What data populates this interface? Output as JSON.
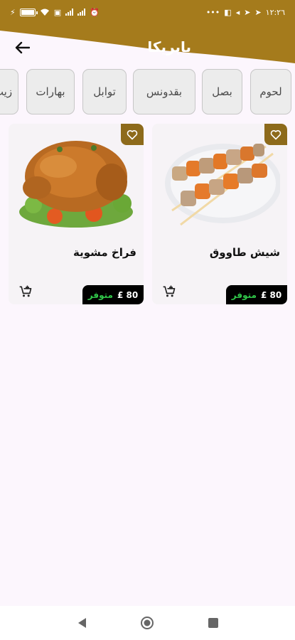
{
  "status_bar": {
    "time": "١٢:٢٦",
    "battery_level": 1.0
  },
  "header": {
    "title": "بابريكا",
    "bg_color": "#a57b1c"
  },
  "categories": [
    {
      "label": "لحوم"
    },
    {
      "label": "بصل"
    },
    {
      "label": "بقدونس"
    },
    {
      "label": "توابل"
    },
    {
      "label": "بهارات"
    },
    {
      "label": "زيت"
    }
  ],
  "products": [
    {
      "name": "شيش طاووق",
      "price": "80 £",
      "stock": "متوفر",
      "image_icon": "shish-tawook-image"
    },
    {
      "name": "فراخ مشوية",
      "price": "80 £",
      "stock": "متوفر",
      "image_icon": "grilled-chicken-image"
    }
  ],
  "colors": {
    "accent": "#a57b1c",
    "badge": "#8d6a1b",
    "stock_green": "#31c84a",
    "background": "#fcf6fd"
  }
}
